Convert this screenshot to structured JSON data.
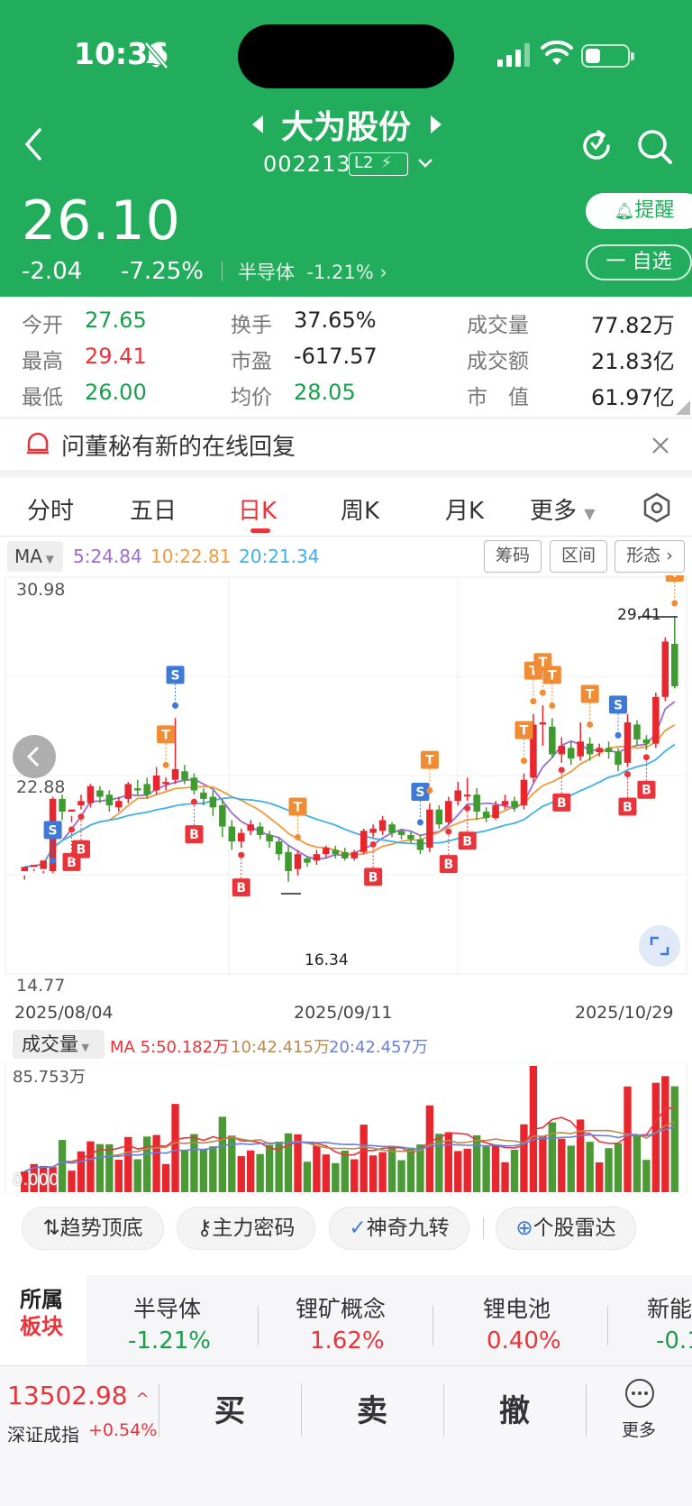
{
  "status": {
    "time": "10:36"
  },
  "header": {
    "title": "大为股份",
    "code": "002213",
    "level_badge": "L2",
    "price": "26.10",
    "change": "-2.04",
    "change_pct": "-7.25%",
    "sector_label": "半导体",
    "sector_change": "-1.21%",
    "remind_label": "提醒",
    "watchlist_label": "一 自选"
  },
  "quote": {
    "open_label": "今开",
    "open": "27.65",
    "high_label": "最高",
    "high": "29.41",
    "low_label": "最低",
    "low": "26.00",
    "turnover_label": "换手",
    "turnover": "37.65%",
    "pe_label": "市盈",
    "pe": "-617.57",
    "avg_label": "均价",
    "avg": "28.05",
    "volume_label": "成交量",
    "volume": "77.82万",
    "amount_label": "成交额",
    "amount": "21.83亿",
    "mktcap_label": "市　值",
    "mktcap": "61.97亿"
  },
  "notice": {
    "text": "问董秘有新的在线回复"
  },
  "tabs": [
    "分时",
    "五日",
    "日K",
    "周K",
    "月K",
    "更多"
  ],
  "ma_bar": {
    "button": "MA",
    "ma5": "5:24.84",
    "ma10": "10:22.81",
    "ma20": "20:21.34",
    "tools": [
      "筹码",
      "区间",
      "形态"
    ]
  },
  "chart_axes": {
    "y_top": "30.98",
    "y_mid": "22.88",
    "y_bottom": "14.77",
    "high_marker": "29.41",
    "low_marker": "16.34",
    "dates": [
      "2025/08/04",
      "2025/09/11",
      "2025/10/29"
    ]
  },
  "signals": {
    "s_label": "S",
    "t_label": "T",
    "b_label": "B"
  },
  "volume_bar": {
    "button": "成交量",
    "ma5": "MA 5:50.182万",
    "ma10": "10:42.415万",
    "ma20": "20:42.457万",
    "max_label": "85.753万",
    "zero_label": "0.000"
  },
  "features": [
    "趋势顶底",
    "主力密码",
    "神奇九转",
    "个股雷达"
  ],
  "sectors": {
    "head_line1": "所属",
    "head_line2": "板块",
    "items": [
      {
        "name": "半导体",
        "pct": "-1.21%"
      },
      {
        "name": "锂矿概念",
        "pct": "1.62%"
      },
      {
        "name": "锂电池",
        "pct": "0.40%"
      },
      {
        "name": "新能",
        "pct": "-0.1"
      }
    ]
  },
  "bottom": {
    "index_value": "13502.98",
    "index_name": "深证成指",
    "index_change": "+0.54%",
    "buy": "买",
    "sell": "卖",
    "cancel": "撤",
    "more": "更多"
  },
  "chart_data": {
    "type": "candlestick",
    "x_dates_shown": [
      "2025/08/04",
      "2025/09/11",
      "2025/10/29"
    ],
    "ylim": [
      14.77,
      30.98
    ],
    "candles": [
      [
        17.4,
        17.6,
        17.2,
        17.0
      ],
      [
        17.6,
        17.7,
        17.5,
        17.4
      ],
      [
        17.5,
        17.9,
        17.4,
        17.3
      ],
      [
        17.4,
        20.8,
        17.3,
        20.9
      ],
      [
        20.8,
        20.2,
        21.0,
        19.8
      ],
      [
        20.2,
        20.3,
        20.0,
        19.7
      ],
      [
        20.5,
        20.7,
        21.0,
        20.3
      ],
      [
        20.6,
        21.4,
        21.5,
        20.4
      ],
      [
        21.2,
        20.9,
        21.4,
        20.6
      ],
      [
        21.0,
        20.5,
        21.2,
        20.2
      ],
      [
        20.4,
        20.7,
        20.9,
        20.2
      ],
      [
        20.8,
        21.5,
        21.6,
        20.6
      ],
      [
        21.3,
        21.2,
        21.7,
        21.0
      ],
      [
        21.5,
        21.0,
        21.8,
        20.8
      ],
      [
        21.2,
        21.9,
        22.3,
        21.0
      ],
      [
        21.5,
        21.6,
        21.8,
        21.2
      ],
      [
        21.7,
        22.2,
        24.6,
        21.5
      ],
      [
        22.1,
        21.7,
        22.4,
        21.5
      ],
      [
        21.8,
        21.2,
        22.0,
        21.0
      ],
      [
        21.1,
        20.8,
        21.3,
        20.5
      ],
      [
        20.9,
        20.4,
        21.2,
        20.0
      ],
      [
        20.5,
        19.5,
        20.8,
        19.0
      ],
      [
        19.5,
        18.8,
        19.8,
        18.4
      ],
      [
        18.8,
        19.2,
        19.4,
        18.5
      ],
      [
        19.3,
        19.6,
        19.8,
        19.1
      ],
      [
        19.5,
        19.1,
        19.7,
        18.9
      ],
      [
        19.1,
        18.8,
        19.3,
        18.5
      ],
      [
        18.8,
        18.2,
        19.0,
        17.9
      ],
      [
        18.3,
        17.4,
        18.6,
        16.9
      ],
      [
        17.5,
        18.2,
        18.4,
        17.2
      ],
      [
        18.0,
        17.8,
        18.1,
        17.6
      ],
      [
        17.9,
        18.2,
        18.4,
        17.7
      ],
      [
        18.2,
        18.5,
        18.6,
        18.0
      ],
      [
        18.4,
        18.2,
        18.6,
        18.0
      ],
      [
        18.3,
        18.0,
        18.5,
        17.9
      ],
      [
        18.0,
        18.3,
        18.4,
        17.9
      ],
      [
        18.3,
        19.3,
        19.4,
        18.2
      ],
      [
        19.2,
        19.4,
        19.6,
        19.0
      ],
      [
        19.3,
        19.8,
        20.0,
        19.1
      ],
      [
        19.6,
        19.2,
        19.7,
        19.0
      ],
      [
        19.3,
        19.1,
        19.4,
        18.9
      ],
      [
        19.1,
        18.9,
        19.3,
        18.7
      ],
      [
        18.9,
        18.4,
        19.1,
        18.2
      ],
      [
        18.5,
        20.3,
        20.6,
        18.3
      ],
      [
        20.3,
        19.6,
        20.5,
        19.4
      ],
      [
        19.7,
        20.7,
        20.9,
        19.6
      ],
      [
        20.7,
        21.2,
        21.6,
        20.5
      ],
      [
        21.0,
        21.0,
        21.8,
        20.7
      ],
      [
        21.0,
        20.2,
        21.3,
        19.8
      ],
      [
        20.2,
        19.9,
        20.4,
        19.7
      ],
      [
        19.9,
        20.5,
        20.7,
        19.8
      ],
      [
        20.5,
        20.7,
        21.0,
        20.3
      ],
      [
        20.7,
        20.4,
        20.9,
        20.2
      ],
      [
        20.5,
        21.7,
        22.0,
        20.3
      ],
      [
        21.8,
        24.3,
        24.8,
        21.6
      ],
      [
        24.3,
        24.4,
        25.2,
        23.3
      ],
      [
        24.2,
        22.9,
        24.6,
        22.7
      ],
      [
        22.9,
        23.3,
        23.7,
        22.5
      ],
      [
        23.2,
        22.7,
        23.5,
        22.4
      ],
      [
        22.8,
        23.5,
        24.4,
        22.6
      ],
      [
        23.4,
        22.9,
        23.7,
        22.6
      ],
      [
        23.0,
        23.2,
        23.4,
        22.8
      ],
      [
        23.2,
        23.0,
        23.5,
        22.7
      ],
      [
        23.0,
        22.4,
        23.2,
        22.1
      ],
      [
        22.5,
        24.4,
        24.8,
        22.3
      ],
      [
        24.3,
        23.6,
        24.5,
        23.3
      ],
      [
        23.6,
        23.4,
        23.8,
        23.1
      ],
      [
        23.4,
        25.6,
        25.8,
        23.2
      ],
      [
        25.6,
        28.2,
        28.4,
        25.4
      ],
      [
        28.1,
        26.1,
        29.41,
        26.0
      ]
    ],
    "ma_lines": {
      "ma5": "purple",
      "ma10": "orange",
      "ma20": "light-blue"
    },
    "volume_ylim": [
      0,
      85.753
    ]
  }
}
